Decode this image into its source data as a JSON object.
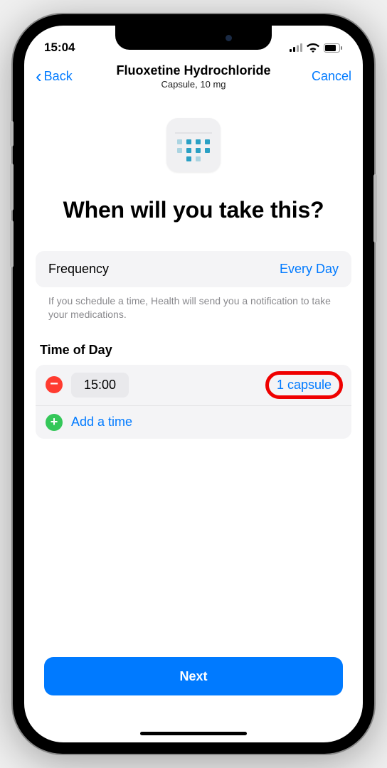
{
  "status": {
    "time": "15:04"
  },
  "nav": {
    "back_label": "Back",
    "title": "Fluoxetine Hydrochloride",
    "subtitle": "Capsule, 10 mg",
    "cancel_label": "Cancel"
  },
  "question": "When will you take this?",
  "frequency": {
    "label": "Frequency",
    "value": "Every Day"
  },
  "hint": "If you schedule a time, Health will send you a notification to take your medications.",
  "time_section": {
    "heading": "Time of Day",
    "entries": [
      {
        "time": "15:00",
        "dose": "1 capsule"
      }
    ],
    "add_label": "Add a time"
  },
  "next_label": "Next"
}
